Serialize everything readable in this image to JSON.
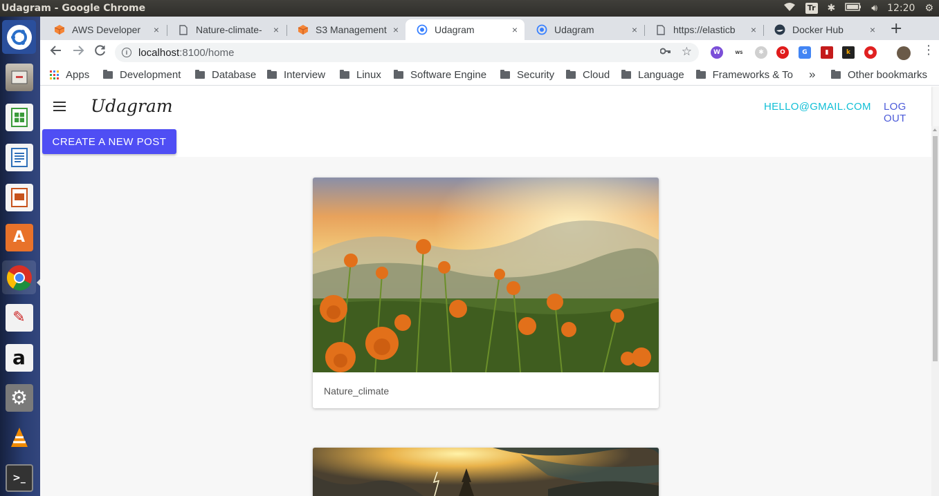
{
  "window": {
    "title": "Udagram - Google Chrome"
  },
  "system_tray": {
    "keyboard_layout": "Tr",
    "clock": "12:20"
  },
  "launcher": {
    "apps": [
      {
        "name": "ubuntu-dash",
        "glyph": "◉",
        "color": "#2a6fc9"
      },
      {
        "name": "files",
        "glyph": "▭",
        "color": "#8a8276"
      },
      {
        "name": "libreoffice-calc",
        "glyph": "▦",
        "color": "#3a9b3a"
      },
      {
        "name": "libreoffice-writer",
        "glyph": "≣",
        "color": "#2f6fb8"
      },
      {
        "name": "libreoffice-impress",
        "glyph": "▤",
        "color": "#c7531d"
      },
      {
        "name": "software-center",
        "glyph": "A",
        "color": "#e8722a"
      },
      {
        "name": "chrome",
        "glyph": "◎",
        "color": "#d93025"
      },
      {
        "name": "pdf-viewer",
        "glyph": "✎",
        "color": "#f2f2f2"
      },
      {
        "name": "amazon",
        "glyph": "a",
        "color": "#f3f3f3"
      },
      {
        "name": "system-settings",
        "glyph": "⚙",
        "color": "#7a7a7a"
      },
      {
        "name": "vlc",
        "glyph": "▲",
        "color": "#f08a00"
      },
      {
        "name": "terminal",
        "glyph": ">_",
        "color": "#333333"
      }
    ]
  },
  "tabs": [
    {
      "label": "AWS Developer",
      "icon": "aws-icon",
      "active": false
    },
    {
      "label": "Nature-climate-",
      "icon": "document-icon",
      "active": false
    },
    {
      "label": "S3 Management",
      "icon": "aws-icon",
      "active": false
    },
    {
      "label": "Udagram",
      "icon": "ionic-icon",
      "active": true
    },
    {
      "label": "Udagram",
      "icon": "ionic-icon",
      "active": false
    },
    {
      "label": "https://elasticb",
      "icon": "document-icon",
      "active": false
    },
    {
      "label": "Docker Hub",
      "icon": "docker-icon",
      "active": false
    }
  ],
  "close_glyph": "×",
  "new_tab_glyph": "+",
  "omnibox": {
    "host": "localhost",
    "path": ":8100/home"
  },
  "bookmarks": {
    "apps_label": "Apps",
    "folders": [
      "Development",
      "Database",
      "Interview",
      "Linux",
      "Software Engine",
      "Security",
      "Cloud",
      "Language",
      "Frameworks & To"
    ],
    "overflow": "»",
    "other": "Other bookmarks"
  },
  "app": {
    "brand": "Udagram",
    "user_email": "HELLO@GMAIL.COM",
    "logout": "LOG OUT",
    "create_post": "CREATE A NEW POST",
    "posts": [
      {
        "caption": "Nature_climate",
        "image": "marigold-field-sunrise"
      },
      {
        "caption": "",
        "image": "stormy-mountain-lightning"
      }
    ]
  },
  "colors": {
    "accent_primary": "#4f4ef4",
    "email_link": "#10bfd6",
    "logout_link": "#4b5ad9"
  }
}
